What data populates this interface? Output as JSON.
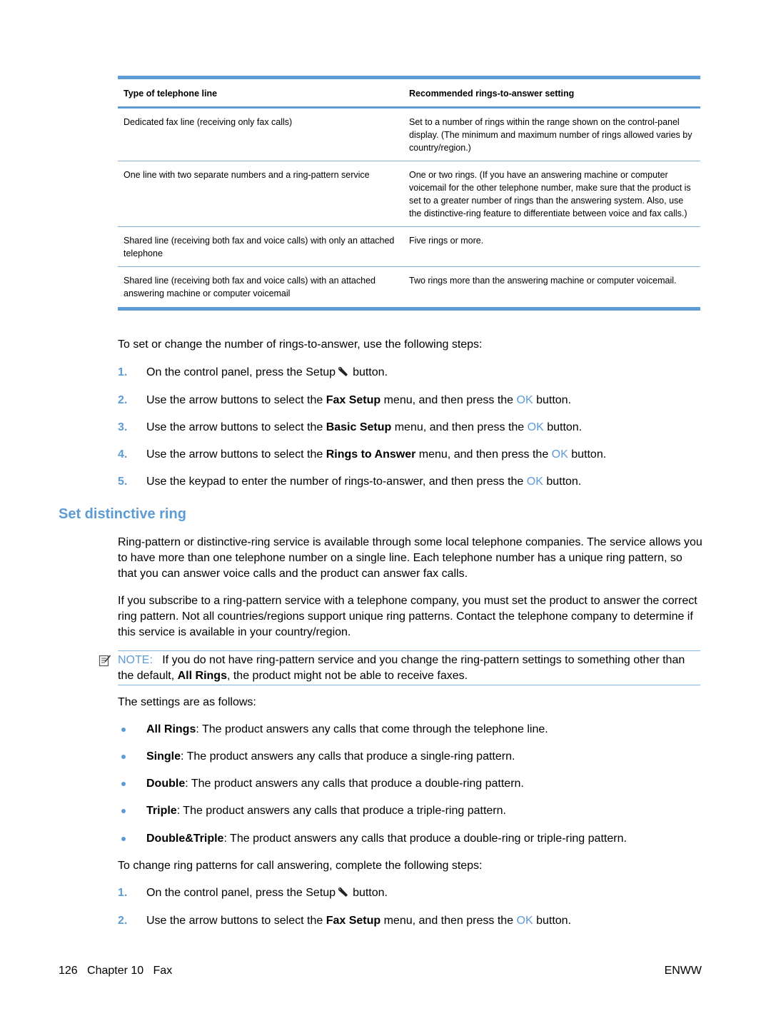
{
  "table": {
    "headers": [
      "Type of telephone line",
      "Recommended rings-to-answer setting"
    ],
    "rows": [
      {
        "line_type": "Dedicated fax line (receiving only fax calls)",
        "setting": "Set to a number of rings within the range shown on the control-panel display. (The minimum and maximum number of rings allowed varies by country/region.)"
      },
      {
        "line_type": "One line with two separate numbers and a ring-pattern service",
        "setting": "One or two rings. (If you have an answering machine or computer voicemail for the other telephone number, make sure that the product is set to a greater number of rings than the answering system. Also, use the distinctive-ring feature to differentiate between voice and fax calls.)"
      },
      {
        "line_type": "Shared line (receiving both fax and voice calls) with only an attached telephone",
        "setting": "Five rings or more."
      },
      {
        "line_type": "Shared line (receiving both fax and voice calls) with an attached answering machine or computer voicemail",
        "setting": "Two rings more than the answering machine or computer voicemail."
      }
    ]
  },
  "rings_intro": "To set or change the number of rings-to-answer, use the following steps:",
  "rings_steps": [
    {
      "num": "1.",
      "pre": "On the control panel, press the Setup",
      "icon": "wrench-icon",
      "post": "button."
    },
    {
      "num": "2.",
      "pre": "Use the arrow buttons to select the ",
      "bold": "Fax Setup",
      "mid": " menu, and then press the ",
      "ok": "OK",
      "post": " button."
    },
    {
      "num": "3.",
      "pre": "Use the arrow buttons to select the ",
      "bold": "Basic Setup",
      "mid": " menu, and then press the ",
      "ok": "OK",
      "post": " button."
    },
    {
      "num": "4.",
      "pre": "Use the arrow buttons to select the ",
      "bold": "Rings to Answer",
      "mid": " menu, and then press the ",
      "ok": "OK",
      "post": " button."
    },
    {
      "num": "5.",
      "pre": "Use the keypad to enter the number of rings-to-answer, and then press the ",
      "ok": "OK",
      "post": " button."
    }
  ],
  "section": {
    "title": "Set distinctive ring",
    "para1": "Ring-pattern or distinctive-ring service is available through some local telephone companies. The service allows you to have more than one telephone number on a single line. Each telephone number has a unique ring pattern, so that you can answer voice calls and the product can answer fax calls.",
    "para2": "If you subscribe to a ring-pattern service with a telephone company, you must set the product to answer the correct ring pattern. Not all countries/regions support unique ring patterns. Contact the telephone company to determine if this service is available in your country/region."
  },
  "note": {
    "label": "NOTE:",
    "pre": "If you do not have ring-pattern service and you change the ring-pattern settings to something other than the default, ",
    "bold": "All Rings",
    "post": ", the product might not be able to receive faxes."
  },
  "settings_intro": "The settings are as follows:",
  "settings": [
    {
      "name": "All Rings",
      "desc": ": The product answers any calls that come through the telephone line."
    },
    {
      "name": "Single",
      "desc": ": The product answers any calls that produce a single-ring pattern."
    },
    {
      "name": "Double",
      "desc": ": The product answers any calls that produce a double-ring pattern."
    },
    {
      "name": "Triple",
      "desc": ": The product answers any calls that produce a triple-ring pattern."
    },
    {
      "name": "Double&Triple",
      "desc": ": The product answers any calls that produce a double-ring or triple-ring pattern."
    }
  ],
  "pattern_intro": "To change ring patterns for call answering, complete the following steps:",
  "pattern_steps": [
    {
      "num": "1.",
      "pre": "On the control panel, press the Setup",
      "icon": "wrench-icon",
      "post": "button."
    },
    {
      "num": "2.",
      "pre": "Use the arrow buttons to select the ",
      "bold": "Fax Setup",
      "mid": " menu, and then press the ",
      "ok": "OK",
      "post": " button."
    }
  ],
  "footer": {
    "left": "126   Chapter 10   Fax",
    "right": "ENWW"
  },
  "colors": {
    "accent": "#5d9bd5"
  }
}
